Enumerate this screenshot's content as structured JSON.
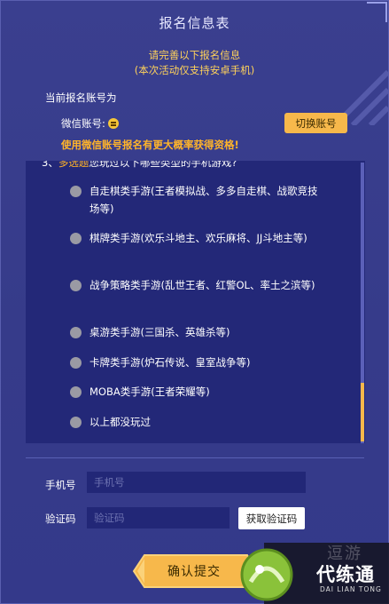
{
  "header": {
    "title": "报名信息表",
    "subtitle_line1": "请完善以下报名信息",
    "subtitle_line2": "(本次活动仅支持安卓手机)"
  },
  "account": {
    "current_label": "当前报名账号为",
    "wechat_label": "微信账号:",
    "switch_button": "切换账号",
    "hint": "使用微信账号报名有更大概率获得资格!"
  },
  "question": {
    "number": "3、",
    "tag": "多选题",
    "text": "您玩过以下哪些类型的手机游戏?",
    "options": [
      {
        "label": "自走棋类手游(王者模拟战、多多自走棋、战歌竞技场等)"
      },
      {
        "label": "棋牌类手游(欢乐斗地主、欢乐麻将、JJ斗地主等)"
      },
      {
        "label": "战争策略类手游(乱世王者、红警OL、率土之滨等)"
      },
      {
        "label": "桌游类手游(三国杀、英雄杀等)"
      },
      {
        "label": "卡牌类手游(炉石传说、皇室战争等)"
      },
      {
        "label": "MOBA类手游(王者荣耀等)"
      },
      {
        "label": "以上都没玩过"
      }
    ]
  },
  "form": {
    "phone_label": "手机号",
    "phone_placeholder": "手机号",
    "code_label": "验证码",
    "code_placeholder": "验证码",
    "get_code_button": "获取验证码"
  },
  "submit": {
    "label": "确认提交"
  },
  "watermark": {
    "brand": "代练通",
    "sub": "DAI LIAN TONG",
    "ghost": "逗游"
  },
  "colors": {
    "background": "#3a3f8f",
    "question_box": "#232878",
    "accent": "#f7b84b",
    "highlight": "#ffb42a"
  }
}
